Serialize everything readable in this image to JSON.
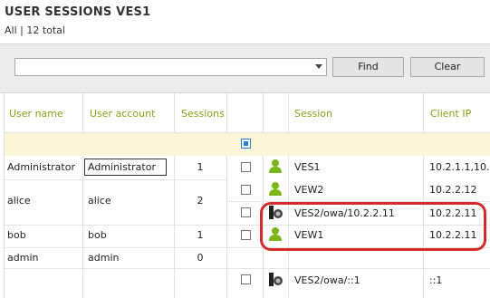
{
  "header": {
    "title": "USER SESSIONS  VES1",
    "subtitle": "All | 12 total"
  },
  "filter": {
    "value": "",
    "find_label": "Find",
    "clear_label": "Clear"
  },
  "columns": {
    "user_name": "User name",
    "user_account": "User account",
    "sessions": "Sessions",
    "session": "Session",
    "client_ip": "Client IP"
  },
  "users": [
    {
      "name": "Administrator",
      "account": "Administrator",
      "sessions": "1"
    },
    {
      "name": "alice",
      "account": "alice",
      "sessions": "2"
    },
    {
      "name": "bob",
      "account": "bob",
      "sessions": "1"
    },
    {
      "name": "admin",
      "account": "admin",
      "sessions": "0"
    }
  ],
  "sessions": [
    {
      "icon": "user-icon",
      "name": "VES1",
      "ip": "10.2.1.1,10..."
    },
    {
      "icon": "user-icon",
      "name": "VEW2",
      "ip": "10.2.2.12"
    },
    {
      "icon": "web-session-icon",
      "name": "VES2/owa/10.2.2.11",
      "ip": "10.2.2.11"
    },
    {
      "icon": "user-icon",
      "name": "VEW1",
      "ip": "10.2.2.11"
    },
    {
      "icon": "web-session-icon",
      "name": "VES2/owa/::1",
      "ip": "::1"
    }
  ],
  "colors": {
    "header_text": "#8aa01c",
    "user_icon": "#7cb518",
    "highlight": "#d42c2c",
    "select_all": "#2b7fd6"
  }
}
